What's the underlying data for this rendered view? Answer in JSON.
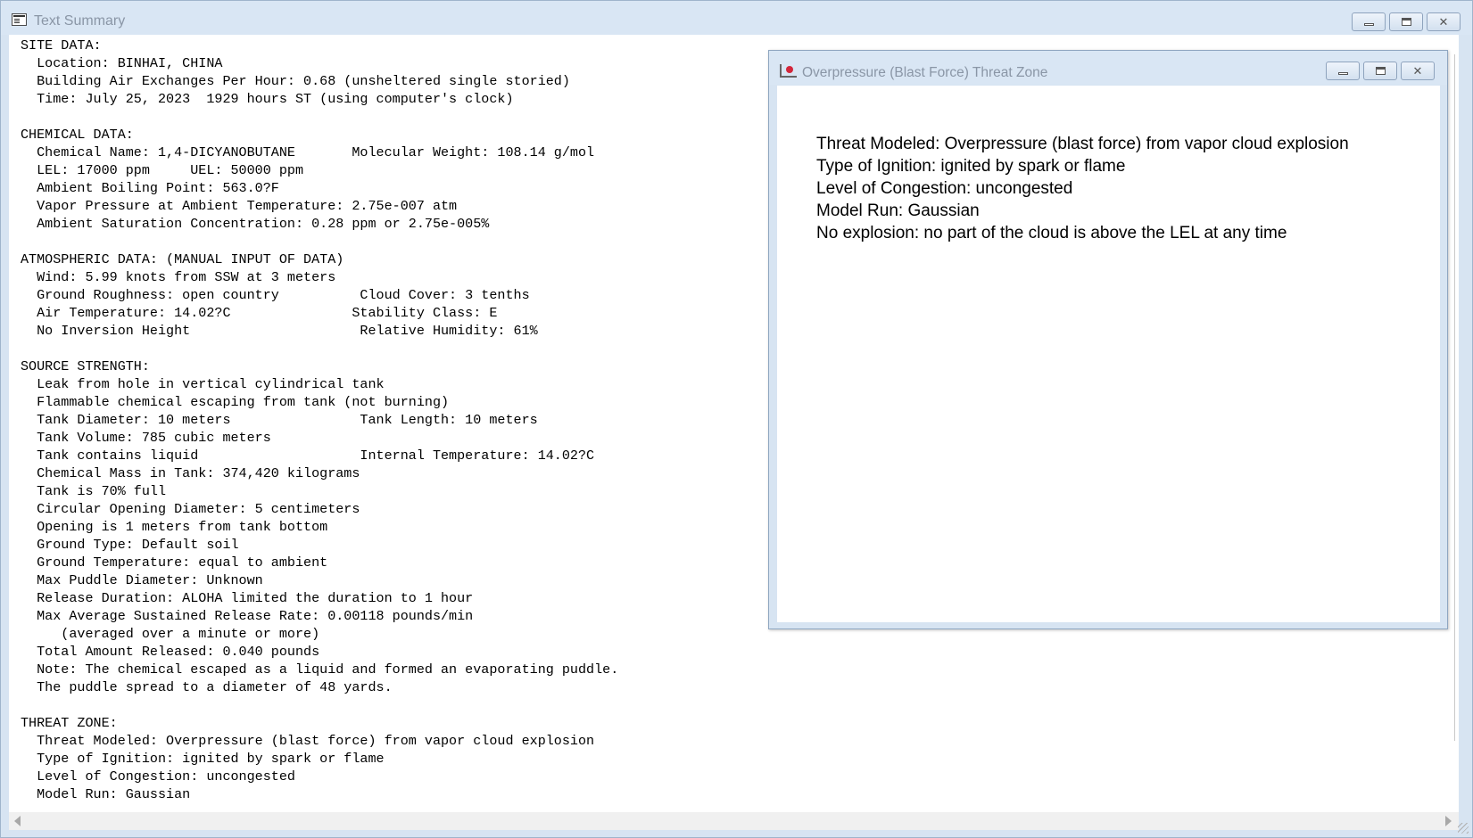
{
  "main_window": {
    "title": "Text Summary"
  },
  "summary_text": "SITE DATA:\n  Location: BINHAI, CHINA\n  Building Air Exchanges Per Hour: 0.68 (unsheltered single storied)\n  Time: July 25, 2023  1929 hours ST (using computer's clock)\n\nCHEMICAL DATA:\n  Chemical Name: 1,4-DICYANOBUTANE       Molecular Weight: 108.14 g/mol\n  LEL: 17000 ppm     UEL: 50000 ppm\n  Ambient Boiling Point: 563.0?F\n  Vapor Pressure at Ambient Temperature: 2.75e-007 atm\n  Ambient Saturation Concentration: 0.28 ppm or 2.75e-005%\n\nATMOSPHERIC DATA: (MANUAL INPUT OF DATA)\n  Wind: 5.99 knots from SSW at 3 meters\n  Ground Roughness: open country          Cloud Cover: 3 tenths\n  Air Temperature: 14.02?C               Stability Class: E\n  No Inversion Height                     Relative Humidity: 61%\n\nSOURCE STRENGTH:\n  Leak from hole in vertical cylindrical tank\n  Flammable chemical escaping from tank (not burning)\n  Tank Diameter: 10 meters                Tank Length: 10 meters\n  Tank Volume: 785 cubic meters\n  Tank contains liquid                    Internal Temperature: 14.02?C\n  Chemical Mass in Tank: 374,420 kilograms\n  Tank is 70% full\n  Circular Opening Diameter: 5 centimeters\n  Opening is 1 meters from tank bottom\n  Ground Type: Default soil\n  Ground Temperature: equal to ambient\n  Max Puddle Diameter: Unknown\n  Release Duration: ALOHA limited the duration to 1 hour\n  Max Average Sustained Release Rate: 0.00118 pounds/min\n     (averaged over a minute or more)\n  Total Amount Released: 0.040 pounds\n  Note: The chemical escaped as a liquid and formed an evaporating puddle.\n  The puddle spread to a diameter of 48 yards.\n\nTHREAT ZONE:\n  Threat Modeled: Overpressure (blast force) from vapor cloud explosion\n  Type of Ignition: ignited by spark or flame\n  Level of Congestion: uncongested\n  Model Run: Gaussian",
  "child_window": {
    "title": "Overpressure (Blast Force) Threat Zone",
    "lines": [
      "Threat Modeled: Overpressure (blast force) from vapor cloud explosion",
      "Type of Ignition: ignited by spark or flame",
      "Level of Congestion: uncongested",
      "Model Run: Gaussian",
      "No explosion: no part of the cloud is above the LEL at any time"
    ]
  },
  "icons": {
    "app": "text-summary-app-icon",
    "child": "threat-zone-chart-icon",
    "minimize": "minimize-icon",
    "maximize": "maximize-icon",
    "close": "close-icon"
  },
  "colors": {
    "window_frame": "#d7e4f2",
    "title_text": "#8a96a6",
    "client_bg": "#ffffff",
    "child_icon_marker": "#d3263b"
  }
}
